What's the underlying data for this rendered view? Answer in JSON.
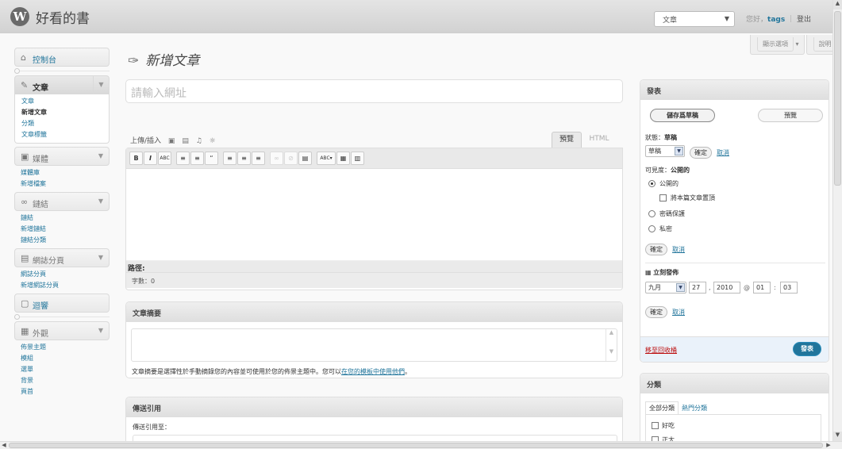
{
  "header": {
    "logo": "W",
    "site_title": "好看的書",
    "favorites_select": "文章",
    "greeting": "您好，",
    "username": "tags",
    "separator": "｜",
    "logout": "登出"
  },
  "screen_meta": {
    "screen_options": "顯示選項",
    "help": "說明"
  },
  "sidebar": {
    "dashboard": "控制台",
    "posts": {
      "label": "文章",
      "items": [
        "文章",
        "新增文章",
        "分類",
        "文章標籤"
      ],
      "current": 1
    },
    "media": {
      "label": "媒體",
      "items": [
        "媒體庫",
        "新增檔案"
      ]
    },
    "links": {
      "label": "鏈結",
      "items": [
        "鏈結",
        "新增鏈結",
        "鏈結分類"
      ]
    },
    "pages": {
      "label": "網誌分頁",
      "items": [
        "網誌分頁",
        "新增網誌分頁"
      ]
    },
    "comments": {
      "label": "迴響"
    },
    "appearance": {
      "label": "外觀",
      "items": [
        "佈景主題",
        "模組",
        "選單",
        "背景",
        "頁首"
      ]
    }
  },
  "page": {
    "title": "新增文章"
  },
  "title_field": {
    "placeholder": "請輸入網址"
  },
  "editor": {
    "upload_insert": "上傳/插入",
    "tab_visual": "預覽",
    "tab_html": "HTML",
    "toolbar": [
      "B",
      "I",
      "ABC",
      "≡",
      "≡",
      "“",
      "≡",
      "≡",
      "≡",
      "∞",
      "⊘",
      "▤",
      "ABC▾",
      "▦",
      "▥"
    ],
    "path_label": "路徑:",
    "word_count": "字數：0"
  },
  "excerpt": {
    "heading": "文章摘要",
    "note_prefix": "文章摘要是選擇性於手動摘錄您的內容並可使用於您的佈景主題中。您可以",
    "note_link": "在您的模板中使用他們",
    "note_suffix": "。"
  },
  "trackback": {
    "heading": "傳送引用",
    "label": "傳送引用至："
  },
  "publish": {
    "heading": "發表",
    "save_draft": "儲存爲草稿",
    "preview": "預覽",
    "status_label": "狀態：",
    "status_value": "草稿",
    "status_select": "草稿",
    "ok": "確定",
    "cancel": "取消",
    "visibility_label": "可見度：",
    "visibility_value": "公開的",
    "radio_public": "公開的",
    "sticky": "將本篇文章置頂",
    "radio_password": "密碼保護",
    "radio_private": "私密",
    "publish_immediately": "立刻發佈",
    "month": "九月",
    "day": "27",
    "year": "2010",
    "at": "@",
    "hour": "01",
    "colon": ":",
    "minute": "03",
    "comma": ",",
    "trash": "移至回收桶",
    "publish_button": "發表"
  },
  "categories": {
    "heading": "分類",
    "tab_all": "全部分類",
    "tab_popular": "熱門分類",
    "items": [
      "好吃",
      "正太"
    ]
  }
}
